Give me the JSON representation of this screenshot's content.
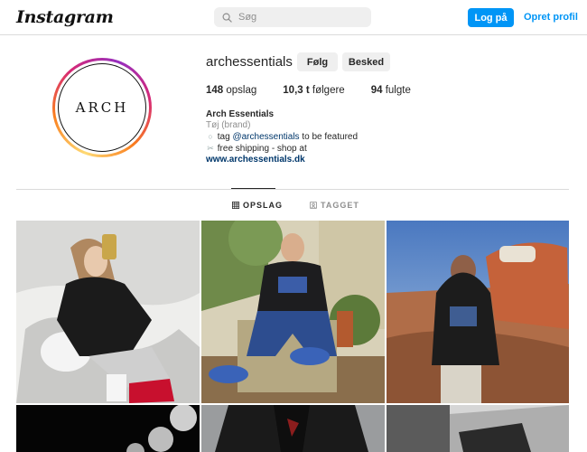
{
  "nav": {
    "logo": "Instagram",
    "search_placeholder": "Søg",
    "login_label": "Log på",
    "signup_label": "Opret profil"
  },
  "profile": {
    "avatar_text": "ARCH",
    "username": "archessentials",
    "follow_label": "Følg",
    "message_label": "Besked",
    "stats": [
      {
        "count": "148",
        "label": "opslag"
      },
      {
        "count": "10,3 t",
        "label": "følgere"
      },
      {
        "count": "94",
        "label": "fulgte"
      }
    ],
    "bio": {
      "name": "Arch Essentials",
      "category": "Tøj (brand)",
      "line1_prefix": "tag ",
      "line1_mention": "@archessentials",
      "line1_suffix": " to be featured",
      "line2": "free shipping - shop at",
      "website": "www.archessentials.dk"
    }
  },
  "tabs": [
    {
      "label": "OPSLAG",
      "icon": "grid-icon",
      "active": true
    },
    {
      "label": "TAGGET",
      "icon": "tagged-icon",
      "active": false
    }
  ],
  "posts": [
    {
      "description": "photo-hoodie-mirror-selfie"
    },
    {
      "description": "photo-hoodie-chair-patio"
    },
    {
      "description": "photo-hoodie-desert-sunset"
    },
    {
      "description": "photo-moons-black"
    },
    {
      "description": "photo-leather-jacket"
    },
    {
      "description": "photo-black-white-wall"
    }
  ],
  "colors": {
    "accent": "#0095f6",
    "link": "#00376b",
    "text": "#262626",
    "muted": "#8e8e8e"
  }
}
